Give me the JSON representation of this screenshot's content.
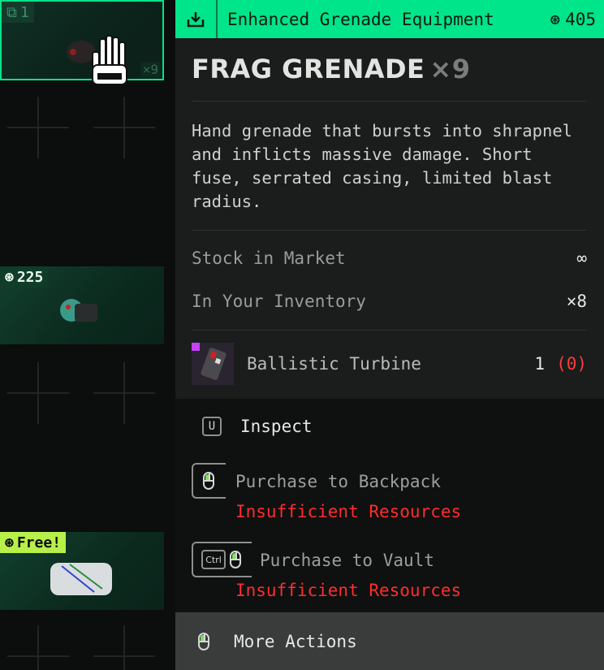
{
  "left_grid": {
    "selected_card": {
      "count_badge": "1",
      "qty": "×9"
    },
    "card_2": {
      "price": "225"
    },
    "card_3": {
      "price": "Free!"
    }
  },
  "header": {
    "title": "Enhanced Grenade Equipment",
    "price": "405",
    "icon": "download-tray-icon",
    "currency_icon": "currency-coin-icon"
  },
  "item": {
    "name": "FRAG GRENADE",
    "qty": "×9",
    "description": "Hand grenade that bursts into shrapnel and inflicts massive damage. Short fuse, serrated casing, limited blast radius."
  },
  "stats": [
    {
      "label": "Stock in Market",
      "value": "∞"
    },
    {
      "label": "In Your Inventory",
      "value": "×8"
    }
  ],
  "requirement": {
    "name": "Ballistic Turbine",
    "have": "1",
    "missing": "(0)"
  },
  "actions": {
    "inspect": {
      "key": "U",
      "label": "Inspect"
    },
    "backpack": {
      "label": "Purchase to Backpack",
      "error": "Insufficient Resources"
    },
    "vault": {
      "key": "Ctrl",
      "label": "Purchase to Vault",
      "error": "Insufficient Resources"
    },
    "more": {
      "label": "More Actions"
    }
  },
  "colors": {
    "accent": "#00e58a",
    "error": "#ff2d2d",
    "free_badge": "#b8f04a"
  }
}
